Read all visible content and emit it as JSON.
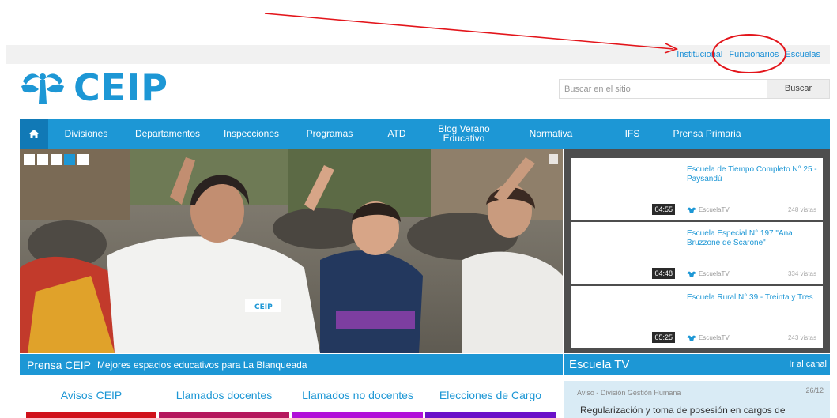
{
  "top_links": [
    "Institucional",
    "Funcionarios",
    "Escuelas"
  ],
  "logo": {
    "text": "CEIP"
  },
  "search": {
    "placeholder": "Buscar en el sitio",
    "button": "Buscar"
  },
  "nav": {
    "items": [
      "Divisiones",
      "Departamentos",
      "Inspecciones",
      "Programas",
      "ATD",
      "Blog Verano Educativo",
      "Normativa",
      "IFS",
      "Prensa Primaria"
    ]
  },
  "hero": {
    "caption_brand": "Prensa CEIP",
    "caption_text": "Mejores espacios educativos para La Blanqueada",
    "coat_logo_text": "CEIP"
  },
  "escuela_tv": {
    "title": "Escuela TV",
    "link": "Ir al canal",
    "videos": [
      {
        "title": "Escuela de Tiempo Completo N° 25 - Paysandú",
        "duration": "04:55",
        "channel": "EscuelaTV",
        "views": "248 vistas"
      },
      {
        "title": "Escuela Especial N° 197 \"Ana Bruzzone de Scarone\"",
        "duration": "04:48",
        "channel": "EscuelaTV",
        "views": "334 vistas"
      },
      {
        "title": "Escuela Rural N° 39 - Treinta y Tres",
        "duration": "05:25",
        "channel": "EscuelaTV",
        "views": "243 vistas"
      }
    ]
  },
  "tabs": [
    "Avisos CEIP",
    "Llamados docentes",
    "Llamados no docentes",
    "Elecciones de Cargo"
  ],
  "tab_colors": [
    "#d0111b",
    "#b5175d",
    "#b10fd9",
    "#6b10c9"
  ],
  "notice": {
    "category": "Aviso - División Gestión Humana",
    "date": "26/12",
    "text": "Regularización y toma de posesión en cargos de"
  },
  "colors": {
    "brand": "#1d97d5",
    "brand_dark": "#1179b6",
    "annotation": "#e3151b"
  }
}
